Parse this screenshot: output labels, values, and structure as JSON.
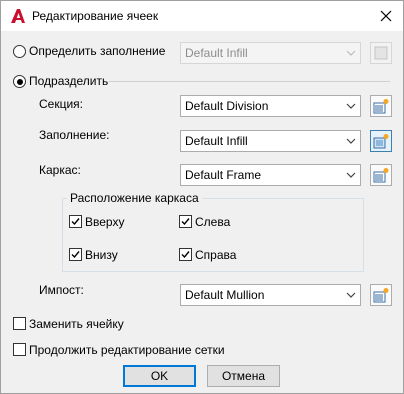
{
  "window": {
    "title": "Редактирование ячеек",
    "app_icon": "autocad-a-icon",
    "close_icon": "close-x-icon"
  },
  "options": {
    "define_fill": {
      "label": "Определить заполнение",
      "selected": false,
      "combo_value": "Default Infill"
    },
    "subdivide": {
      "label": "Подразделить",
      "selected": true
    }
  },
  "fields": {
    "section": {
      "label": "Секция:",
      "value": "Default Division"
    },
    "infill": {
      "label": "Заполнение:",
      "value": "Default Infill"
    },
    "frame": {
      "label": "Каркас:",
      "value": "Default Frame"
    },
    "mullion": {
      "label": "Импост:",
      "value": "Default Mullion"
    }
  },
  "frame_location": {
    "title": "Расположение каркаса",
    "top": {
      "label": "Вверху",
      "checked": true
    },
    "left": {
      "label": "Слева",
      "checked": true
    },
    "bottom": {
      "label": "Внизу",
      "checked": true
    },
    "right": {
      "label": "Справа",
      "checked": true
    }
  },
  "checkboxes": {
    "replace_cell": {
      "label": "Заменить ячейку",
      "checked": false
    },
    "continue_edit": {
      "label": "Продолжить редактирование сетки",
      "checked": false
    }
  },
  "buttons": {
    "ok": "OK",
    "cancel": "Отмена"
  },
  "colors": {
    "accent": "#0078d7",
    "brand_red": "#c8102e",
    "dialog_bg": "#f0f0f0"
  }
}
